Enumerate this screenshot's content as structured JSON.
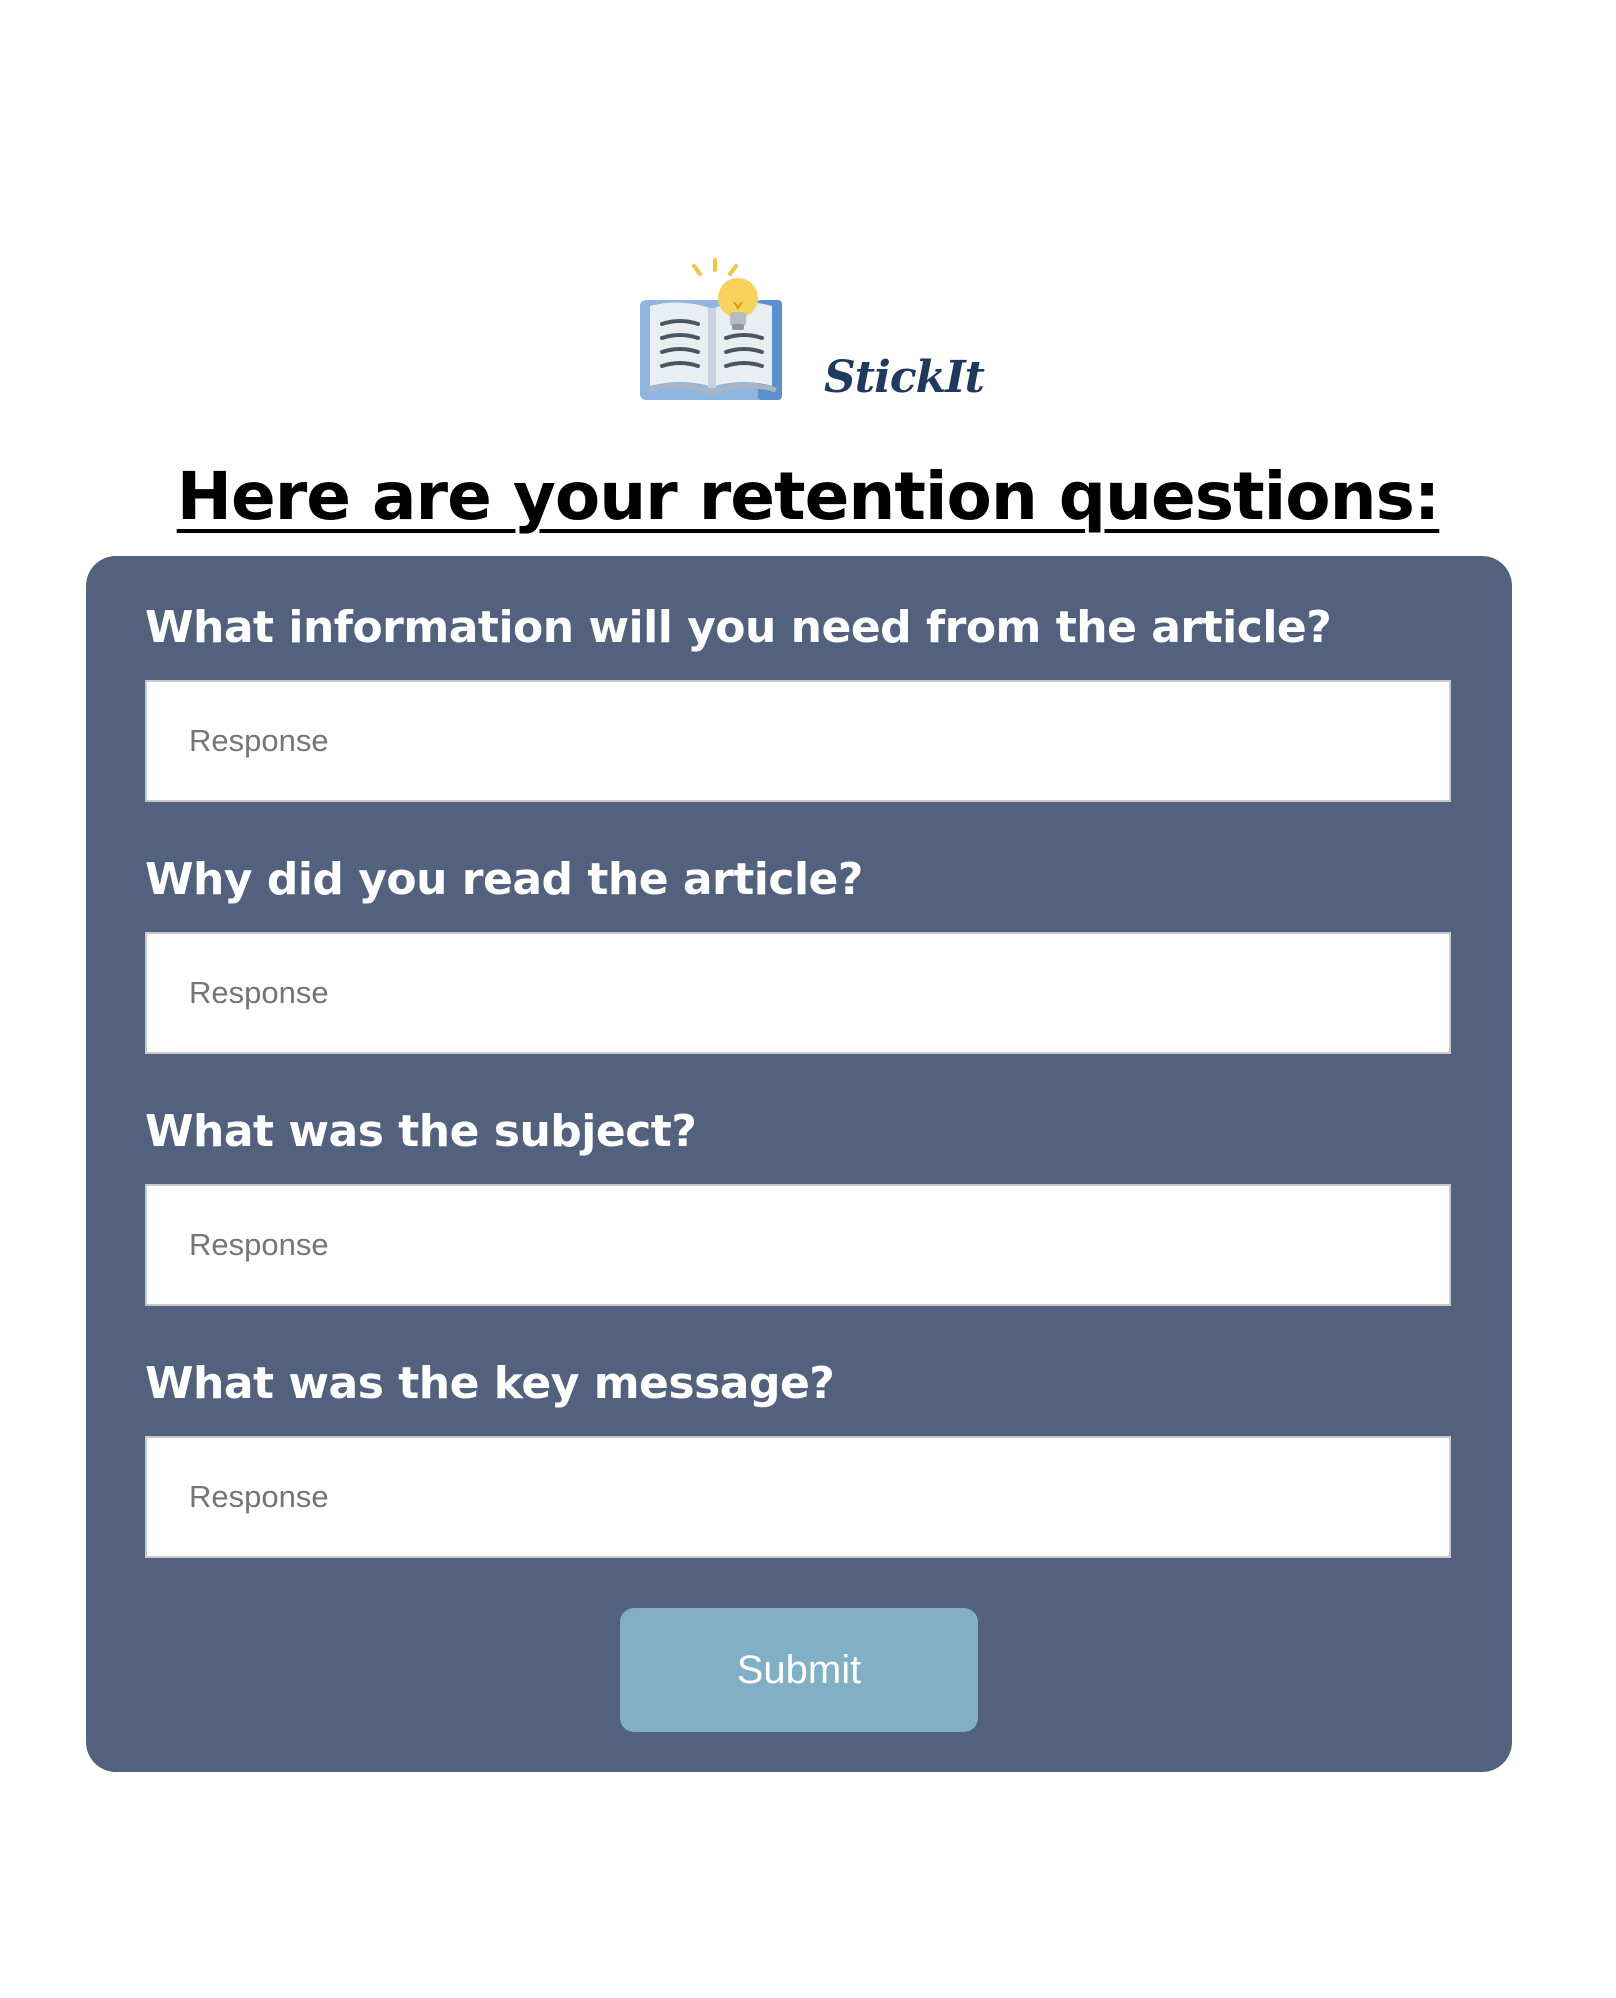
{
  "brand": {
    "name": "StickIt",
    "icon": "open-book-lightbulb-icon"
  },
  "page": {
    "title": "Here are your retention questions:"
  },
  "form": {
    "questions": [
      {
        "label": "What information will you need from the article?",
        "placeholder": "Response",
        "value": ""
      },
      {
        "label": "Why did you read the article?",
        "placeholder": "Response",
        "value": ""
      },
      {
        "label": "What was the subject?",
        "placeholder": "Response",
        "value": ""
      },
      {
        "label": "What was the key message?",
        "placeholder": "Response",
        "value": ""
      }
    ],
    "submit_label": "Submit"
  },
  "colors": {
    "card_background": "#52617e",
    "submit_button": "#80afc6",
    "brand_text": "#1f3a5f",
    "title_text": "#000000"
  }
}
